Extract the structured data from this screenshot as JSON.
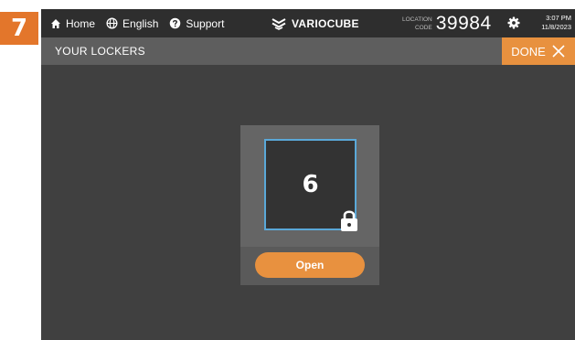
{
  "step": {
    "number": "7"
  },
  "topbar": {
    "nav": [
      {
        "label": "Home",
        "icon": "home-icon"
      },
      {
        "label": "English",
        "icon": "globe-icon"
      },
      {
        "label": "Support",
        "icon": "help-icon"
      }
    ],
    "brand": "VARIOCUBE",
    "location": {
      "label_line1": "LOCATION",
      "label_line2": "CODE",
      "code": "39984"
    },
    "settings_icon": "gear-icon",
    "clock": {
      "time": "3:07 PM",
      "date": "11/8/2023"
    }
  },
  "subbar": {
    "title": "YOUR LOCKERS",
    "done_label": "DONE"
  },
  "locker": {
    "number": "6",
    "status_icon": "lock-icon",
    "open_label": "Open"
  },
  "colors": {
    "accent": "#e8913f",
    "badge": "#e3762b",
    "tile_border": "#5aa8d8",
    "background": "#404040"
  }
}
